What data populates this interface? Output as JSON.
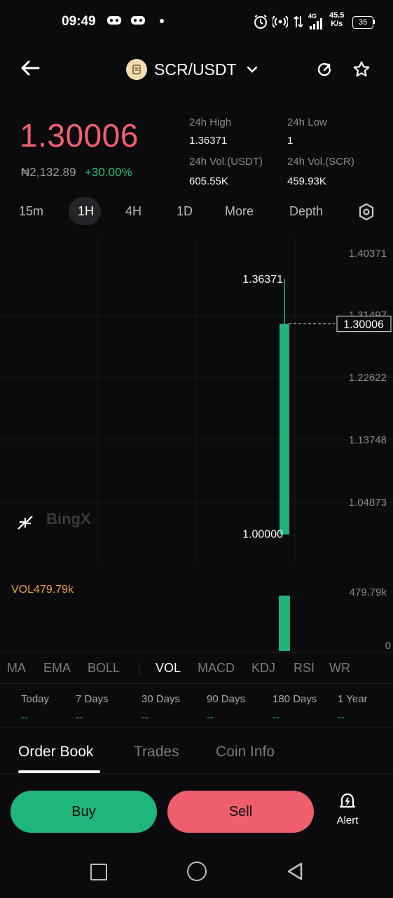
{
  "status_bar": {
    "time": "09:49",
    "net_speed_value": "45.5",
    "net_speed_unit": "K/s",
    "network": "4G",
    "battery": "35"
  },
  "header": {
    "pair": "SCR/USDT"
  },
  "ticker": {
    "last_price": "1.30006",
    "fiat_price": "₦2,132.89",
    "change": "+30.00%",
    "high_label": "24h High",
    "high_value": "1.36371",
    "low_label": "24h Low",
    "low_value": "1",
    "vol_usdt_label": "24h Vol.(USDT)",
    "vol_usdt_value": "605.55K",
    "vol_scr_label": "24h Vol.(SCR)",
    "vol_scr_value": "459.93K"
  },
  "intervals": [
    "15m",
    "1H",
    "4H",
    "1D",
    "More",
    "Depth"
  ],
  "chart": {
    "y_ticks": [
      "1.40371",
      "1.31497",
      "1.22622",
      "1.13748",
      "1.04873"
    ],
    "current_price_tag": "1.30006",
    "high_marker": "1.36371",
    "low_marker": "1.00000",
    "watermark": "BingX",
    "vol_label": "VOL479.79k",
    "vol_ticks": [
      "479.79k",
      "0"
    ]
  },
  "chart_data": {
    "type": "candlestick",
    "candles": [
      {
        "open": 1.0,
        "high": 1.36371,
        "low": 1.0,
        "close": 1.30006,
        "volume": 479790
      }
    ],
    "ylim": [
      0.99,
      1.40371
    ],
    "grid": true,
    "colors": {
      "up": "#22b37a"
    }
  },
  "indicators": [
    "MA",
    "EMA",
    "BOLL",
    "VOL",
    "MACD",
    "KDJ",
    "RSI",
    "WR"
  ],
  "active_indicator": "VOL",
  "performance": {
    "periods": [
      "Today",
      "7 Days",
      "30 Days",
      "90 Days",
      "180 Days",
      "1 Year"
    ],
    "values": [
      "--",
      "--",
      "--",
      "--",
      "--",
      "--"
    ]
  },
  "bottom_tabs": [
    "Order Book",
    "Trades",
    "Coin Info"
  ],
  "actions": {
    "buy": "Buy",
    "sell": "Sell",
    "alert": "Alert"
  },
  "colors": {
    "up": "#20b57a",
    "down": "#ef5e6d",
    "background": "#0b0b0d",
    "accent_vol": "#e6a23c"
  }
}
